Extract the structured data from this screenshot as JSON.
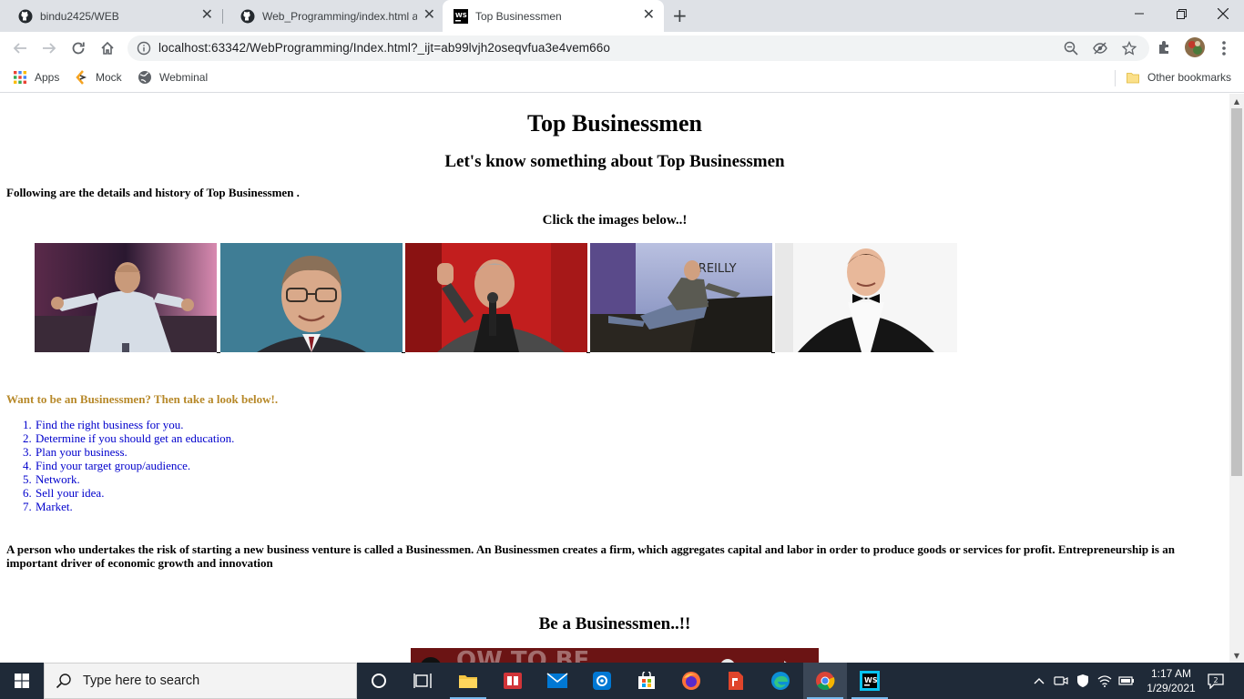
{
  "browser": {
    "tabs": [
      {
        "title": "bindu2425/WEB",
        "icon": "github-icon"
      },
      {
        "title": "Web_Programming/index.html at",
        "icon": "github-icon"
      },
      {
        "title": "Top Businessmen",
        "icon": "webstorm-icon"
      }
    ],
    "url": "localhost:63342/WebProgramming/Index.html?_ijt=ab99lvjh2oseqvfua3e4vem66o",
    "bookmarks": [
      {
        "label": "Apps",
        "icon": "apps-grid-icon"
      },
      {
        "label": "Mock",
        "icon": "mock-icon"
      },
      {
        "label": "Webminal",
        "icon": "globe-icon"
      }
    ],
    "other_bookmarks": "Other bookmarks"
  },
  "page": {
    "title": "Top Businessmen",
    "subtitle": "Let's know something about Top Businessmen",
    "intro": "Following are the details and history of Top Businessmen .",
    "click_prompt": "Click the images below..!",
    "images": [
      {
        "name": "businessman-photo-1"
      },
      {
        "name": "businessman-photo-2"
      },
      {
        "name": "businessman-photo-3"
      },
      {
        "name": "businessman-photo-4"
      },
      {
        "name": "businessman-photo-5"
      }
    ],
    "want_heading": "Want to be an Businessmen? Then take a look below!.",
    "steps": [
      {
        "num": "1.",
        "text": "Find the right business for you."
      },
      {
        "num": "2.",
        "text": "Determine if you should get an education."
      },
      {
        "num": "3.",
        "text": "Plan your business."
      },
      {
        "num": "4.",
        "text": "Find your target group/audience."
      },
      {
        "num": "5.",
        "text": "Network."
      },
      {
        "num": "6.",
        "text": "Sell your idea."
      },
      {
        "num": "7.",
        "text": "Market."
      }
    ],
    "paragraph": "A person who undertakes the risk of starting a new business venture is called a Businessmen. An Businessmen creates a firm, which aggregates capital and labor in order to produce goods or services for profit. Entrepreneurship is an important driver of economic growth and innovation",
    "section_heading": "Be a Businessmen..!!"
  },
  "taskbar": {
    "search_placeholder": "Type here to search",
    "time": "1:17 AM",
    "date": "1/29/2021",
    "notification_count": "2"
  },
  "colors": {
    "want_heading": "#b7892a",
    "list_text": "#0000cc",
    "taskbar": "#1f2a38"
  }
}
